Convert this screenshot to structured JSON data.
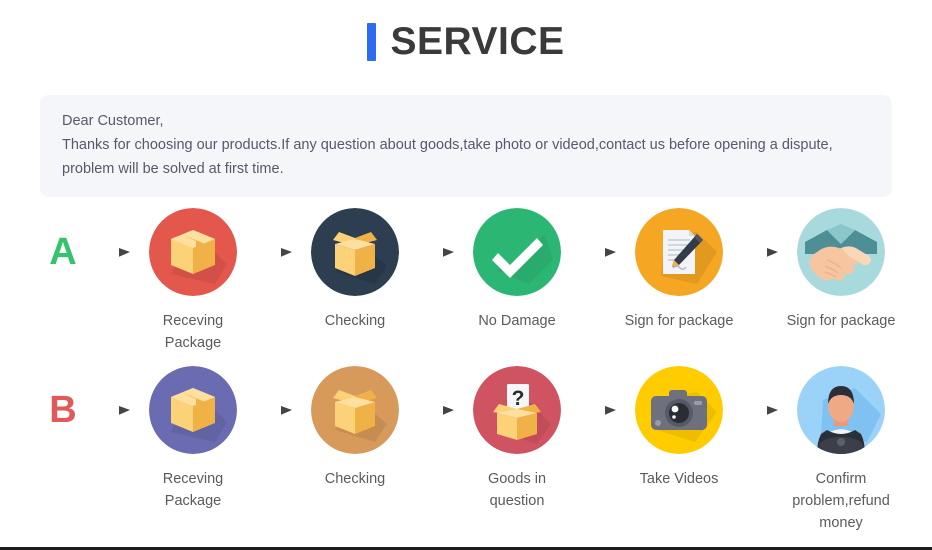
{
  "header": {
    "accent_color": "#2f6bf0",
    "title": "SERVICE"
  },
  "notice": {
    "line1": "Dear Customer,",
    "line2": "Thanks for choosing our products.If any question about goods,take photo or videod,contact us before opening a dispute,",
    "line3": "problem will be solved at first time."
  },
  "flows": [
    {
      "letter": "A",
      "letter_color": "#33c46c",
      "steps": [
        {
          "label": "Receving Package",
          "icon": "closed-box-icon",
          "circle_color": "#e4574c"
        },
        {
          "label": "Checking",
          "icon": "open-box-icon",
          "circle_color": "#2c3e50"
        },
        {
          "label": "No Damage",
          "icon": "check-mark-icon",
          "circle_color": "#2bb673"
        },
        {
          "label": "Sign for package",
          "icon": "document-pen-icon",
          "circle_color": "#f5a623"
        },
        {
          "label": "Sign for package",
          "icon": "handshake-icon",
          "circle_color": "#a8dadd"
        }
      ]
    },
    {
      "letter": "B",
      "letter_color": "#e05a5a",
      "steps": [
        {
          "label": "Receving Package",
          "icon": "closed-box-icon",
          "circle_color": "#6a6bb0"
        },
        {
          "label": "Checking",
          "icon": "open-box-icon",
          "circle_color": "#d79a5b"
        },
        {
          "label": "Goods in question",
          "icon": "question-box-icon",
          "circle_color": "#cf5360"
        },
        {
          "label": "Take Videos",
          "icon": "camera-icon",
          "circle_color": "#ffcc00"
        },
        {
          "label": "Confirm problem,refund money",
          "icon": "person-avatar-icon",
          "circle_color": "#9bd2f7"
        }
      ]
    }
  ]
}
